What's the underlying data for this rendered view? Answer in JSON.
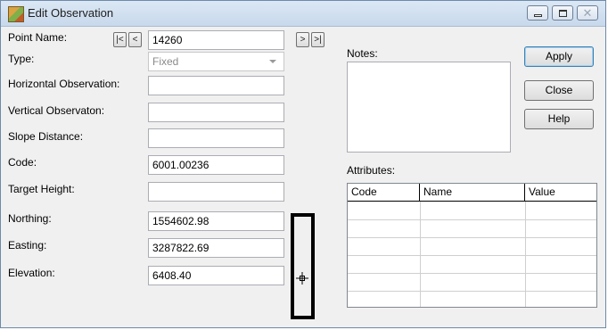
{
  "window": {
    "title": "Edit Observation"
  },
  "fields": {
    "point_name": {
      "label": "Point Name:",
      "value": "14260"
    },
    "type": {
      "label": "Type:",
      "value": "Fixed"
    },
    "horizontal_observation": {
      "label": "Horizontal Observation:",
      "value": ""
    },
    "vertical_observation": {
      "label": "Vertical Observaton:",
      "value": ""
    },
    "slope_distance": {
      "label": "Slope Distance:",
      "value": ""
    },
    "code": {
      "label": "Code:",
      "value": "6001.00236"
    },
    "target_height": {
      "label": "Target Height:",
      "value": ""
    },
    "northing": {
      "label": "Northing:",
      "value": "1554602.98"
    },
    "easting": {
      "label": "Easting:",
      "value": "3287822.69"
    },
    "elevation": {
      "label": "Elevation:",
      "value": "6408.40"
    }
  },
  "nav_buttons": {
    "first": "|<",
    "prev": "<",
    "next": ">",
    "last": ">|"
  },
  "notes": {
    "label": "Notes:",
    "value": ""
  },
  "attributes": {
    "label": "Attributes:",
    "columns": [
      "Code",
      "Name",
      "Value"
    ],
    "rows": []
  },
  "buttons": {
    "apply": "Apply",
    "close": "Close",
    "help": "Help"
  },
  "icons": {
    "title": "edit-observation-icon",
    "pick": "crosshair-pick-icon"
  }
}
